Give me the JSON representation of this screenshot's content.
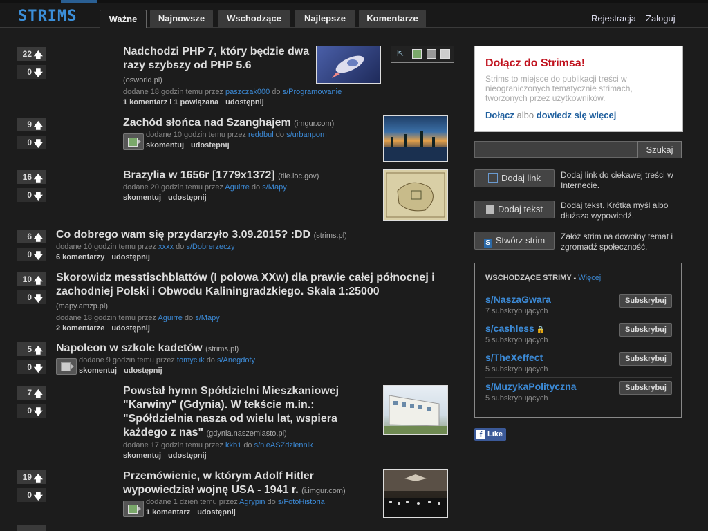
{
  "header": {
    "logo": "STRIMS",
    "tabs": [
      "Ważne",
      "Najnowsze",
      "Wschodzące",
      "Najlepsze",
      "Komentarze"
    ],
    "register": "Rejestracja",
    "login": "Zaloguj"
  },
  "posts": [
    {
      "up": "22",
      "down": "0",
      "title": "Nadchodzi PHP 7, który będzie dwa razy szybszy od PHP 5.6",
      "domain": "(osworld.pl)",
      "meta_prefix": "dodane 18 godzin temu przez",
      "user": "paszczak000",
      "meta_to": "do",
      "strim": "s/Programowanie",
      "actions": [
        "1 komentarz i 1 powiązana",
        "udostępnij"
      ]
    },
    {
      "up": "9",
      "down": "0",
      "title": "Zachód słońca nad Szanghajem",
      "domain": "(imgur.com)",
      "meta_prefix": "dodane 10 godzin temu przez",
      "user": "reddbul",
      "meta_to": "do",
      "strim": "s/urbanporn",
      "actions": [
        "skomentuj",
        "udostępnij"
      ]
    },
    {
      "up": "16",
      "down": "0",
      "title": "Brazylia w 1656r [1779x1372]",
      "domain": "(tile.loc.gov)",
      "meta_prefix": "dodane 20 godzin temu przez",
      "user": "Aguirre",
      "meta_to": "do",
      "strim": "s/Mapy",
      "actions": [
        "skomentuj",
        "udostępnij"
      ]
    },
    {
      "up": "6",
      "down": "0",
      "title": "Co dobrego wam się przydarzyło 3.09.2015? :DD",
      "domain": "(strims.pl)",
      "meta_prefix": "dodane 10 godzin temu przez",
      "user": "xxxx",
      "meta_to": "do",
      "strim": "s/Dobrerzeczy",
      "actions": [
        "6 komentarzy",
        "udostępnij"
      ]
    },
    {
      "up": "10",
      "down": "0",
      "title": "Skorowidz messtischblattów (I połowa XXw) dla prawie całej północnej i zachodniej Polski i Obwodu Kaliningradzkiego. Skala 1:25000",
      "domain": "(mapy.amzp.pl)",
      "meta_prefix": "dodane 18 godzin temu przez",
      "user": "Aguirre",
      "meta_to": "do",
      "strim": "s/Mapy",
      "actions": [
        "2 komentarze",
        "udostępnij"
      ]
    },
    {
      "up": "5",
      "down": "0",
      "title": "Napoleon w szkole kadetów",
      "domain": "(strims.pl)",
      "meta_prefix": "dodane 9 godzin temu przez",
      "user": "tomyclik",
      "meta_to": "do",
      "strim": "s/Anegdoty",
      "actions": [
        "skomentuj",
        "udostępnij"
      ]
    },
    {
      "up": "7",
      "down": "0",
      "title": "Powstał hymn Spółdzielni Mieszkaniowej \"Karwiny\" (Gdynia). W tekście m.in.: \"Spółdzielnia nasza od wielu lat, wspiera każdego z nas\"",
      "domain": "(gdynia.naszemiasto.pl)",
      "meta_prefix": "dodane 17 godzin temu przez",
      "user": "kkb1",
      "meta_to": "do",
      "strim": "s/nieASZdziennik",
      "actions": [
        "skomentuj",
        "udostępnij"
      ]
    },
    {
      "up": "19",
      "down": "0",
      "title": "Przemówienie, w którym Adolf Hitler wypowiedział wojnę USA - 1941 r.",
      "domain": "(i.imgur.com)",
      "meta_prefix": "dodane 1 dzień temu przez",
      "user": "Agrypin",
      "meta_to": "do",
      "strim": "s/FotoHistoria",
      "actions": [
        "1 komentarz",
        "udostępnij"
      ]
    }
  ],
  "sidebar": {
    "join_title": "Dołącz do Strimsa!",
    "join_text": "Strims to miejsce do publikacji treści w nieograniczonych tematycznie strimach, tworzonych przez użytkowników.",
    "join_link": "Dołącz",
    "join_or": "albo",
    "learn_more": "dowiedz się więcej",
    "search_placeholder": "",
    "search_button": "Szukaj",
    "add_link": "Dodaj link",
    "add_link_desc": "Dodaj link do ciekawej treści w Internecie.",
    "add_text": "Dodaj tekst",
    "add_text_desc": "Dodaj tekst. Krótka myśl albo dłuższa wypowiedź.",
    "create_strim": "Stwórz strim",
    "create_strim_desc": "Załóż strim na dowolny temat i zgromadź społeczność.",
    "rising_title": "WSCHODZĄCE STRIMY -",
    "rising_more": "Więcej",
    "subscribe": "Subskrybuj",
    "rising": [
      {
        "name": "s/NaszaGwara",
        "subs": "7 subskrybujących"
      },
      {
        "name": "s/cashless",
        "subs": "5 subskrybujących"
      },
      {
        "name": "s/TheXeffect",
        "subs": "5 subskrybujących"
      },
      {
        "name": "s/MuzykaPolityczna",
        "subs": "5 subskrybujących"
      }
    ],
    "fb_like": "Like",
    "fb_icon": "f"
  },
  "colors": {
    "accent": "#3c8ad6",
    "join_title": "#c0111d",
    "background": "#1c1c1c"
  }
}
